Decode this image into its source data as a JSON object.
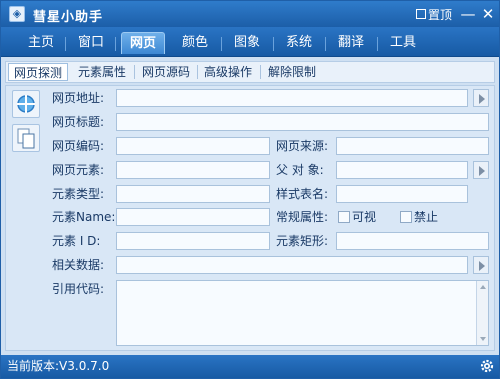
{
  "window": {
    "title": "彗星小助手",
    "pin_label": "置顶",
    "minimize_glyph": "—",
    "close_glyph": "✕"
  },
  "menu": {
    "tabs": [
      {
        "label": "主页"
      },
      {
        "label": "窗口"
      },
      {
        "label": "网页",
        "active": true
      },
      {
        "label": "颜色"
      },
      {
        "label": "图象"
      },
      {
        "label": "系统"
      },
      {
        "label": "翻译"
      },
      {
        "label": "工具"
      }
    ]
  },
  "subtabs": [
    {
      "label": "网页探测",
      "active": true
    },
    {
      "label": "元素属性"
    },
    {
      "label": "网页源码"
    },
    {
      "label": "高级操作"
    },
    {
      "label": "解除限制"
    }
  ],
  "form": {
    "url_label": "网页地址:",
    "title_label": "网页标题:",
    "encoding_label": "网页编码:",
    "source_label": "网页来源:",
    "element_label": "网页元素:",
    "parent_label": "父 对 象:",
    "element_type_label": "元素类型:",
    "style_name_label": "样式表名:",
    "element_name_label": "元素Name:",
    "common_attr_label": "常规属性:",
    "visible_label": "可视",
    "disabled_label": "禁止",
    "element_id_label": "元素 I D:",
    "element_rect_label": "元素矩形:",
    "related_data_label": "相关数据:",
    "ref_code_label": "引用代码:",
    "url_value": "",
    "title_value": "",
    "encoding_value": "",
    "source_value": "",
    "element_value": "",
    "parent_value": "",
    "element_type_value": "",
    "style_name_value": "",
    "element_name_value": "",
    "element_id_value": "",
    "element_rect_value": "",
    "related_data_value": ""
  },
  "status": {
    "version_text": "当前版本:V3.0.7.0"
  },
  "icons": {
    "target": "crosshair-target-icon",
    "copy": "copy-pages-icon",
    "arrow": "arrow-right-icon",
    "gear": "gear-icon"
  },
  "colors": {
    "titlebar": "#1c5ea8",
    "panel": "#d9e7f6",
    "label_text": "#1a3a66"
  }
}
